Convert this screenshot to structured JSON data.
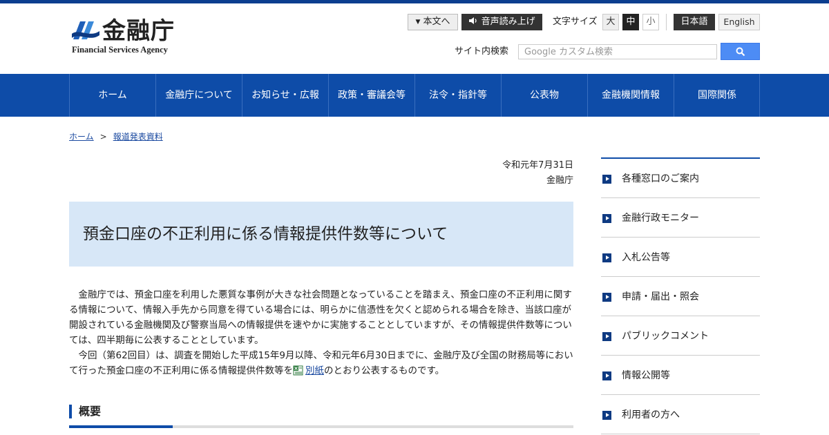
{
  "header": {
    "logo_kanji": "金融庁",
    "logo_english": "Financial Services Agency",
    "skip_to_content": "本文へ",
    "voice_reader": "音声読み上げ",
    "font_size_label": "文字サイズ",
    "font_sizes": [
      "大",
      "中",
      "小"
    ],
    "lang_japanese": "日本語",
    "lang_english": "English",
    "search_label": "サイト内検索",
    "search_placeholder": "Google カスタム検索"
  },
  "nav": [
    {
      "label": "ホーム"
    },
    {
      "label": "金融庁について"
    },
    {
      "label": "お知らせ・広報"
    },
    {
      "label": "政策・審議会等"
    },
    {
      "label": "法令・指針等"
    },
    {
      "label": "公表物"
    },
    {
      "label": "金融機関情報"
    },
    {
      "label": "国際関係"
    }
  ],
  "breadcrumb": {
    "home": "ホーム",
    "separator": ">",
    "current": "報道発表資料"
  },
  "article": {
    "date": "令和元年7月31日",
    "agency": "金融庁",
    "title": "預金口座の不正利用に係る情報提供件数等について",
    "para1": "金融庁では、預金口座を利用した悪質な事例が大きな社会問題となっていることを踏まえ、預金口座の不正利用に関する情報について、情報入手先から同意を得ている場合には、明らかに信憑性を欠くと認められる場合を除き、当該口座が開設されている金融機関及び警察当局への情報提供を速やかに実施することとしていますが、その情報提供件数等については、四半期毎に公表することとしています。",
    "para2_before": "今回（第62回目）は、調査を開始した平成15年9月以降、令和元年6月30日までに、金融庁及び全国の財務局等において行った預金口座の不正利用に係る情報提供件数等を",
    "para2_link": "別紙",
    "para2_after": "のとおり公表するものです。",
    "section_heading": "概要"
  },
  "sidebar": {
    "items": [
      {
        "label": "各種窓口のご案内"
      },
      {
        "label": "金融行政モニター"
      },
      {
        "label": "入札公告等"
      },
      {
        "label": "申請・届出・照会"
      },
      {
        "label": "パブリックコメント"
      },
      {
        "label": "情報公開等"
      },
      {
        "label": "利用者の方へ"
      }
    ]
  },
  "colors": {
    "primary_blue": "#0e4ca8",
    "title_bg": "#d7e7f7",
    "search_button": "#4d8cf5"
  },
  "icons": [
    "speaker-icon",
    "search-icon",
    "excel-file-icon",
    "arrow-marker-icon"
  ]
}
